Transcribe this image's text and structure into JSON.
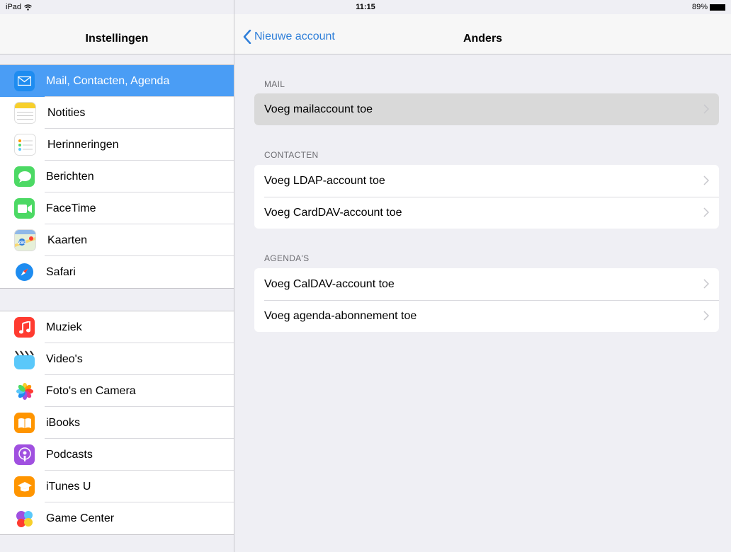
{
  "status_bar": {
    "device": "iPad",
    "time": "11:15",
    "battery": "89%"
  },
  "master": {
    "title": "Instellingen",
    "group1": [
      {
        "id": "mail",
        "label": "Mail, Contacten, Agenda",
        "icon": "mail-icon",
        "color": "#1e8cf0",
        "selected": true
      },
      {
        "id": "notes",
        "label": "Notities",
        "icon": "notes-icon",
        "color": "#ffffff"
      },
      {
        "id": "reminders",
        "label": "Herinneringen",
        "icon": "reminders-icon",
        "color": "#ffffff"
      },
      {
        "id": "messages",
        "label": "Berichten",
        "icon": "messages-icon",
        "color": "#4cd964"
      },
      {
        "id": "facetime",
        "label": "FaceTime",
        "icon": "facetime-icon",
        "color": "#4cd964"
      },
      {
        "id": "maps",
        "label": "Kaarten",
        "icon": "maps-icon",
        "color": "#e6f0d8"
      },
      {
        "id": "safari",
        "label": "Safari",
        "icon": "safari-icon",
        "color": "#ffffff"
      }
    ],
    "group2": [
      {
        "id": "music",
        "label": "Muziek",
        "icon": "music-icon",
        "color": "#ff3b30"
      },
      {
        "id": "videos",
        "label": "Video's",
        "icon": "videos-icon",
        "color": "#5ac8fa"
      },
      {
        "id": "photos",
        "label": "Foto's en Camera",
        "icon": "photos-icon",
        "color": "#ffffff"
      },
      {
        "id": "ibooks",
        "label": "iBooks",
        "icon": "ibooks-icon",
        "color": "#ff9500"
      },
      {
        "id": "podcasts",
        "label": "Podcasts",
        "icon": "podcasts-icon",
        "color": "#a050e0"
      },
      {
        "id": "itunesu",
        "label": "iTunes U",
        "icon": "itunesu-icon",
        "color": "#ff9500"
      },
      {
        "id": "gamecenter",
        "label": "Game Center",
        "icon": "gamecenter-icon",
        "color": "#ffffff"
      }
    ]
  },
  "detail": {
    "back_label": "Nieuwe account",
    "title": "Anders",
    "sections": [
      {
        "header": "MAIL",
        "rows": [
          {
            "label": "Voeg mailaccount toe",
            "highlighted": true
          }
        ]
      },
      {
        "header": "CONTACTEN",
        "rows": [
          {
            "label": "Voeg LDAP-account toe"
          },
          {
            "label": "Voeg CardDAV-account toe"
          }
        ]
      },
      {
        "header": "AGENDA'S",
        "rows": [
          {
            "label": "Voeg CalDAV-account toe"
          },
          {
            "label": "Voeg agenda-abonnement toe"
          }
        ]
      }
    ]
  },
  "colors": {
    "accent": "#2f7fd9",
    "selected_row": "#4a9df5",
    "background": "#efeff4"
  }
}
